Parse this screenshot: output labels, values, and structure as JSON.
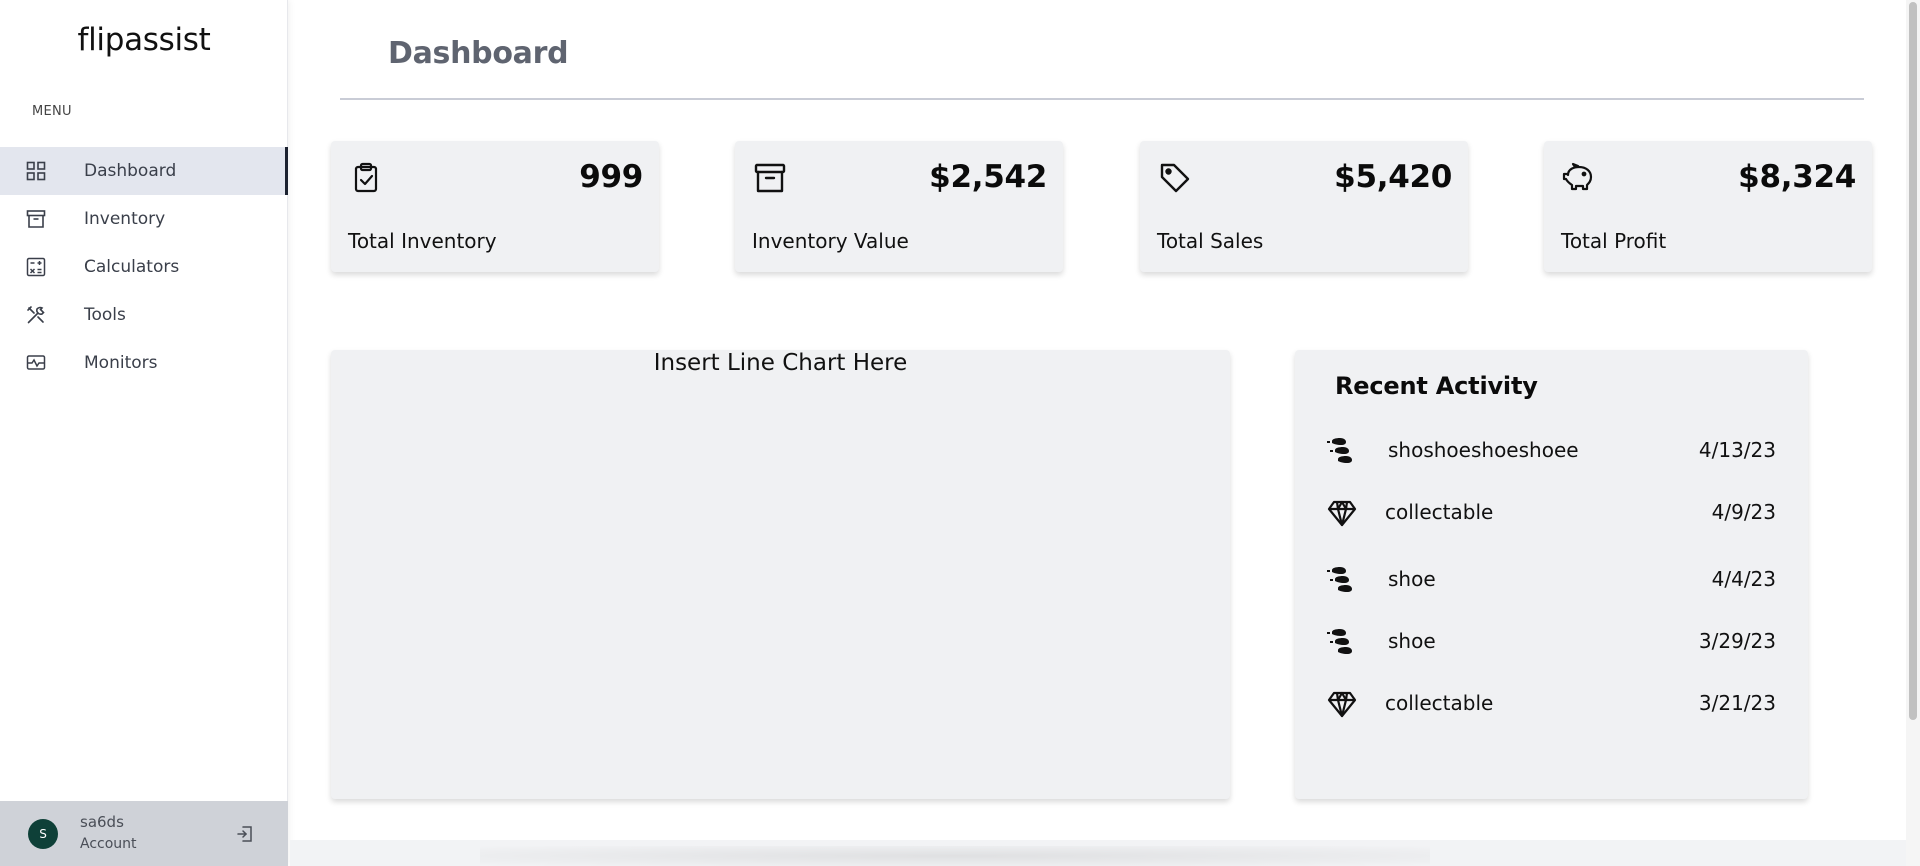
{
  "sidebar": {
    "logo": "flipassist",
    "menu_label": "MENU",
    "items": [
      {
        "label": "Dashboard",
        "icon": "grid-icon",
        "active": true
      },
      {
        "label": "Inventory",
        "icon": "archive-icon",
        "active": false
      },
      {
        "label": "Calculators",
        "icon": "calculator-icon",
        "active": false
      },
      {
        "label": "Tools",
        "icon": "tools-icon",
        "active": false
      },
      {
        "label": "Monitors",
        "icon": "monitor-icon",
        "active": false
      }
    ],
    "account": {
      "initial": "S",
      "name": "sa6ds",
      "sub": "Account",
      "logout_icon": "logout-icon"
    }
  },
  "header": {
    "title": "Dashboard"
  },
  "stats": [
    {
      "value": "999",
      "label": "Total Inventory",
      "icon": "clipboard-check-icon"
    },
    {
      "value": "$2,542",
      "label": "Inventory Value",
      "icon": "archive-icon"
    },
    {
      "value": "$5,420",
      "label": "Total Sales",
      "icon": "tag-icon"
    },
    {
      "value": "$8,324",
      "label": "Total Profit",
      "icon": "piggy-bank-icon"
    }
  ],
  "chart": {
    "placeholder": "Insert Line Chart Here"
  },
  "activity": {
    "title": "Recent Activity",
    "items": [
      {
        "name": "shoshoeshoeshoee",
        "date": "4/13/23",
        "icon": "shoe-icon"
      },
      {
        "name": "collectable",
        "date": "4/9/23",
        "icon": "diamond-icon"
      },
      {
        "name": "shoe",
        "date": "4/4/23",
        "icon": "shoe-icon"
      },
      {
        "name": "shoe",
        "date": "3/29/23",
        "icon": "shoe-icon"
      },
      {
        "name": "collectable",
        "date": "3/21/23",
        "icon": "diamond-icon"
      }
    ]
  },
  "colors": {
    "avatar_bg": "#0e4038",
    "active_nav_bg": "#e3e6ee",
    "card_bg": "#f0f1f3",
    "title_color": "#5f6470"
  }
}
